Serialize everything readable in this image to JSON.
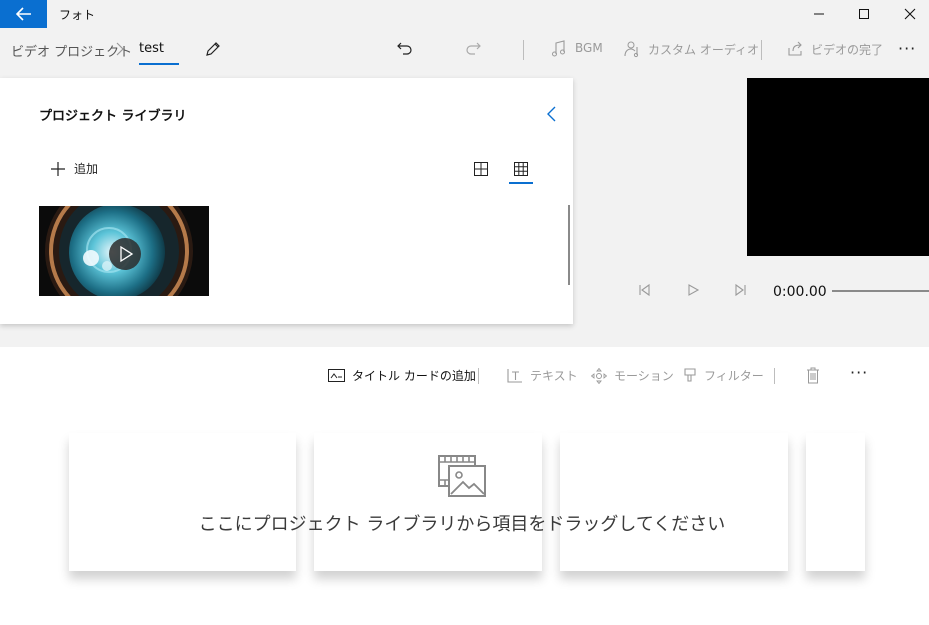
{
  "titlebar": {
    "app_title": "フォト"
  },
  "breadcrumb": {
    "root": "ビデオ プロジェクト",
    "current": "test"
  },
  "command_bar": {
    "bgm_label": "BGM",
    "custom_audio_label": "カスタム オーディオ",
    "finish_video_label": "ビデオの完了",
    "more_label": "···"
  },
  "library": {
    "title": "プロジェクト ライブラリ",
    "add_label": "追加"
  },
  "preview": {
    "time": "0:00.00"
  },
  "storyboard": {
    "title_card_label": "タイトル カードの追加",
    "text_label": "テキスト",
    "motion_label": "モーション",
    "filter_label": "フィルター",
    "more_label": "···",
    "drop_message": "ここにプロジェクト ライブラリから項目をドラッグしてください"
  },
  "colors": {
    "accent": "#0a6fd0",
    "disabled": "#9a9a9a"
  }
}
